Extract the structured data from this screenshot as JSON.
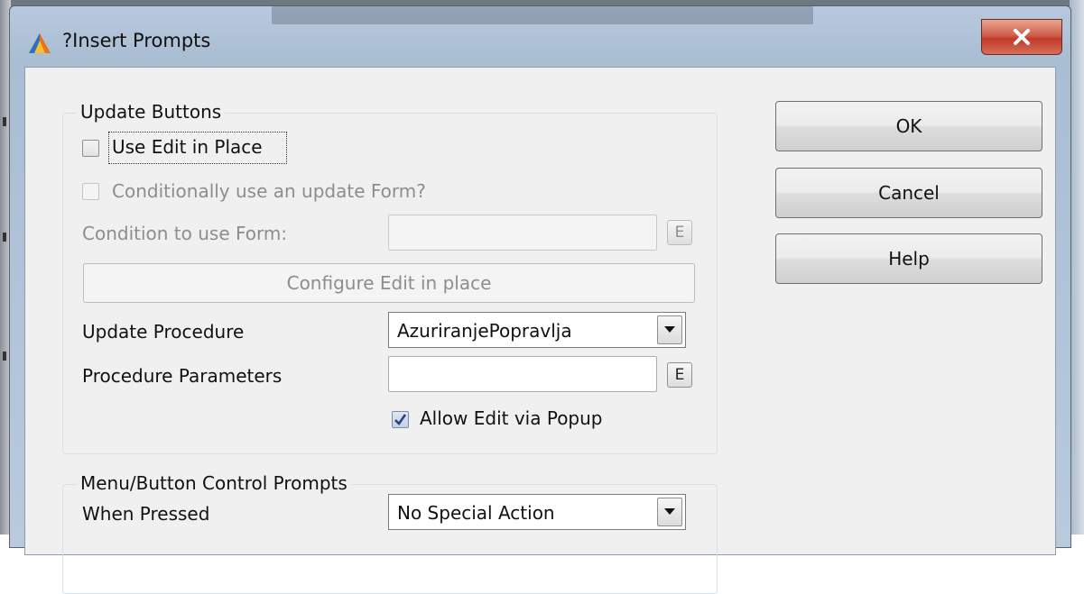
{
  "window": {
    "title": "?Insert Prompts",
    "accent": "#c0392b"
  },
  "update_buttons": {
    "group_title": "Update Buttons",
    "use_edit_in_place": {
      "label": "Use Edit in Place",
      "checked": false
    },
    "conditional_form": {
      "label": "Conditionally use an update Form?",
      "checked": false,
      "enabled": false
    },
    "condition_label": "Condition to use Form:",
    "condition_value": "",
    "expression_button": "E",
    "configure_button": "Configure Edit in place",
    "update_procedure": {
      "label": "Update Procedure",
      "value": "AzuriranjePopravlja"
    },
    "procedure_parameters": {
      "label": "Procedure Parameters",
      "value": ""
    },
    "allow_popup": {
      "label": "Allow Edit via Popup",
      "checked": true
    }
  },
  "menu_prompts": {
    "group_title": "Menu/Button Control Prompts",
    "when_pressed": {
      "label": "When Pressed",
      "value": "No Special Action"
    }
  },
  "buttons": {
    "ok": "OK",
    "cancel": "Cancel",
    "help": "Help"
  },
  "icons": {
    "app": "triangle-logo-icon",
    "close": "close-icon",
    "dropdown": "chevron-down-icon",
    "check": "checkmark-icon"
  }
}
